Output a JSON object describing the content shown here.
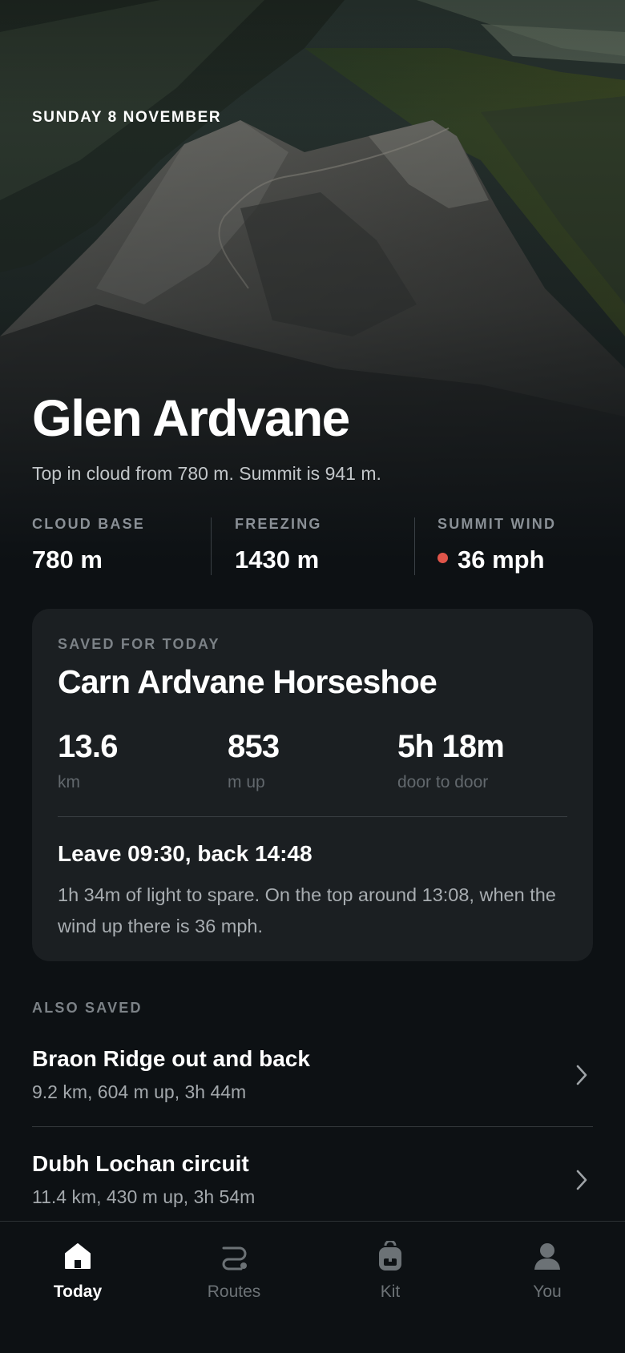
{
  "hero": {
    "date": "SUNDAY 8 NOVEMBER",
    "title": "Glen Ardvane",
    "subtitle": "Top in cloud from 780 m. Summit is 941 m."
  },
  "conditions": [
    {
      "label": "CLOUD BASE",
      "value": "780 m"
    },
    {
      "label": "FREEZING",
      "value": "1430 m"
    },
    {
      "label": "SUMMIT WIND",
      "value": "36 mph",
      "indicator_color": "#e0554a"
    }
  ],
  "saved_today": {
    "kicker": "SAVED FOR TODAY",
    "route_name": "Carn Ardvane Horseshoe",
    "metrics": [
      {
        "value": "13.6",
        "unit": "km"
      },
      {
        "value": "853",
        "unit": "m up"
      },
      {
        "value": "5h 18m",
        "unit": "door to door"
      }
    ],
    "plan": "Leave 09:30, back 14:48",
    "note": "1h 34m of light to spare. On the top around 13:08, when the wind up there is 36 mph."
  },
  "also_saved": {
    "label": "ALSO SAVED",
    "routes": [
      {
        "name": "Braon Ridge out and back",
        "meta": "9.2 km, 604 m up, 3h 44m",
        "icon": "chevron-right-icon"
      },
      {
        "name": "Dubh Lochan circuit",
        "meta": "11.4 km, 430 m up, 3h 54m",
        "icon": "chevron-right-icon"
      }
    ]
  },
  "tabbar": {
    "active": "Today",
    "tabs": [
      {
        "label": "Today",
        "icon": "home-icon"
      },
      {
        "label": "Routes",
        "icon": "route-icon"
      },
      {
        "label": "Kit",
        "icon": "backpack-icon"
      },
      {
        "label": "You",
        "icon": "user-icon"
      }
    ]
  },
  "colors": {
    "background": "#0d1114",
    "card": "#1b1f22",
    "wind_alert": "#e0554a",
    "muted": "#8a9096"
  }
}
